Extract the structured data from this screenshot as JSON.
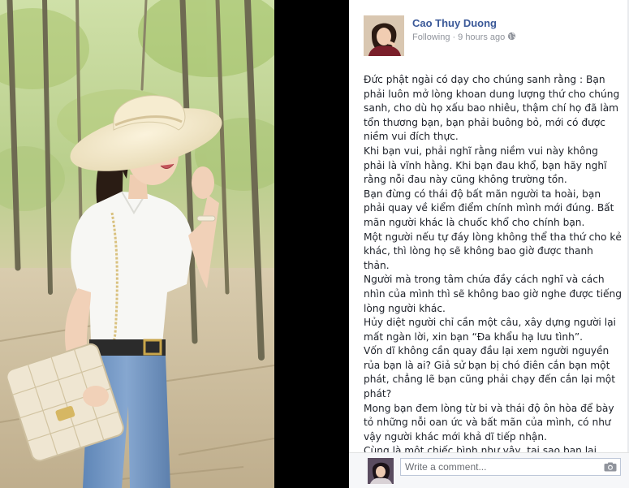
{
  "post": {
    "author_name": "Cao Thuy Duong",
    "following": "Following",
    "separator": "·",
    "time": "9 hours ago",
    "paragraphs": [
      "Đức phật ngài có dạy cho chúng sanh rằng : Bạn phải luôn mở lòng khoan dung lượng thứ cho chúng sanh, cho dù họ xấu bao nhiêu, thậm chí họ đã làm tổn thương bạn, bạn phải buông bỏ, mới có được niềm vui đích thực.",
      "Khi bạn vui, phải nghĩ rằng niềm vui này không phải là vĩnh hằng. Khi bạn đau khổ, bạn hãy nghĩ rằng nỗi đau này cũng không trường tồn.",
      "Bạn đừng có thái độ bất mãn người ta hoài, bạn phải quay về kiểm điểm chính mình mới đúng. Bất mãn người khác là chuốc khổ cho chính bạn.",
      "Một người nếu tự đáy lòng không thể tha thứ cho kẻ khác, thì lòng họ sẽ không bao giờ được thanh thản.",
      "Người mà trong tâm chứa đầy cách nghĩ và cách nhìn của mình thì sẽ không bao giờ nghe được tiếng lòng người khác.",
      "Hủy diệt người chỉ cần một câu, xây dựng người lại mất ngàn lời, xin bạn “Đa khẩu hạ lưu tình”.",
      "Vốn dĩ không cần quay đầu lại xem người nguyền rủa bạn là ai? Giả sử bạn bị chó điên cắn bạn một phát, chẳng lẽ bạn cũng phải chạy đến cắn lại một phát?",
      "Mong bạn đem lòng từ bi và thái độ ôn hòa để bày tỏ những nỗi oan ức và bất mãn của mình, có như vậy người khác mới khả dĩ tiếp nhận.",
      "Cùng là một chiếc bình như vậy, tại sao bạn lại chứa độc dược? Cùng một mảnh tâm tại sao bạn phải chứa"
    ]
  },
  "comment": {
    "placeholder": "Write a comment..."
  },
  "icons": {
    "globe": "globe-icon",
    "camera": "camera-icon"
  },
  "colors": {
    "author_link": "#3b5998",
    "meta": "#90949c",
    "body_text": "#1d2129",
    "backdrop": "#000000",
    "comment_bar": "#f6f7f9"
  }
}
